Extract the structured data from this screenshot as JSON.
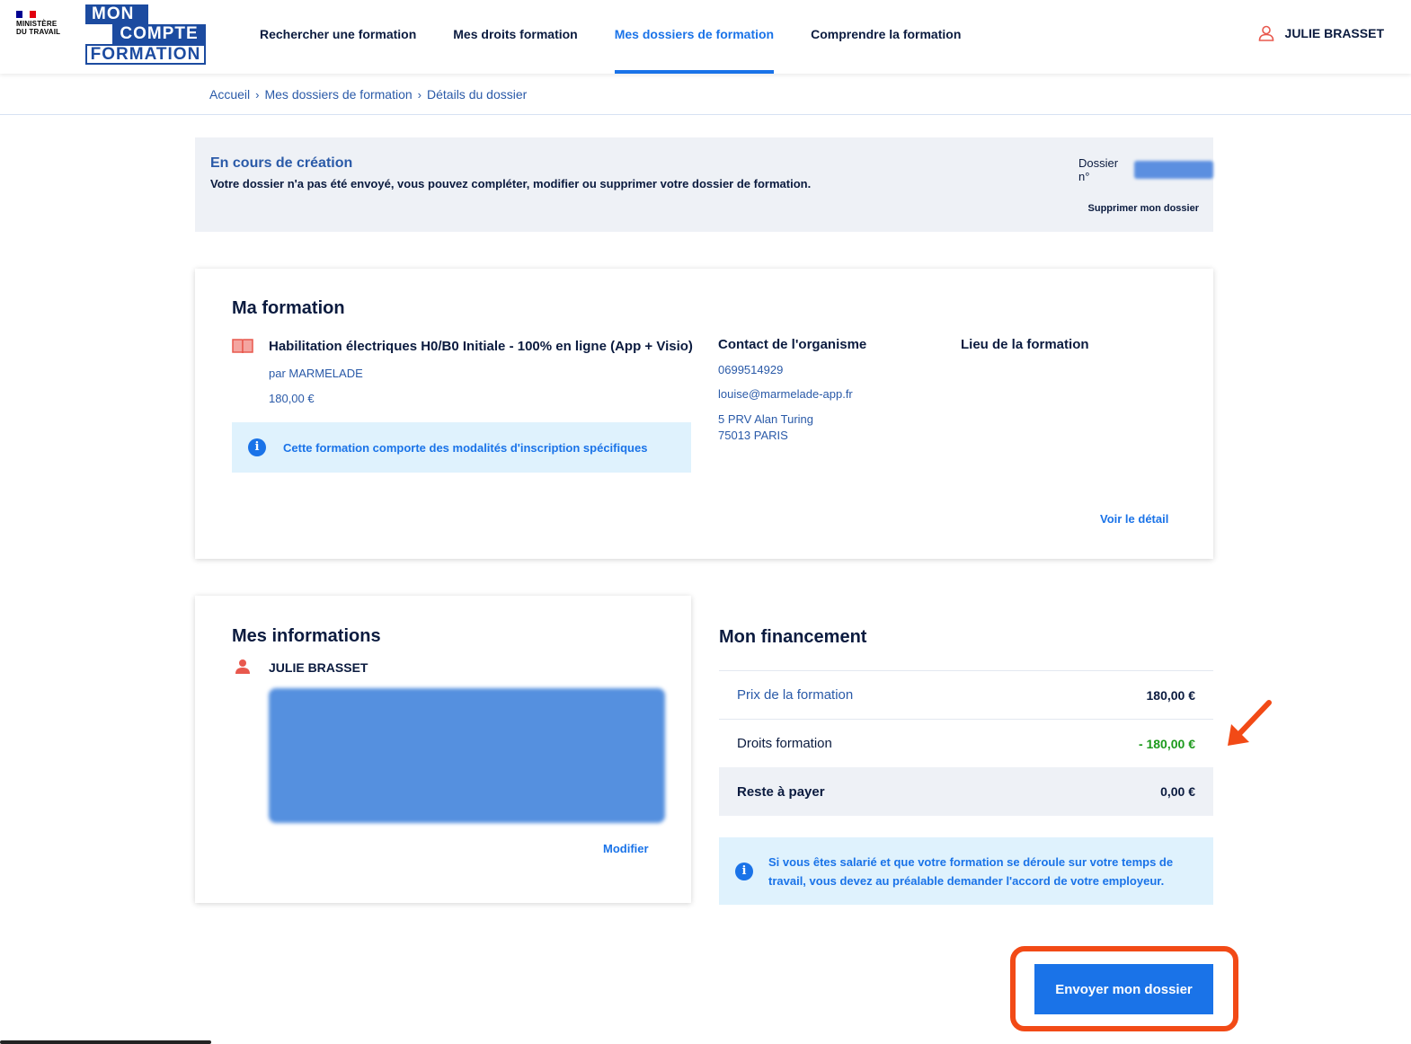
{
  "header": {
    "ministere_line1": "MINISTÈRE",
    "ministere_line2": "DU TRAVAIL",
    "logo_line1": "MON",
    "logo_line2": "COMPTE",
    "logo_line3": "FORMATION",
    "nav": [
      {
        "label": "Rechercher une formation",
        "active": false
      },
      {
        "label": "Mes droits formation",
        "active": false
      },
      {
        "label": "Mes dossiers de formation",
        "active": true
      },
      {
        "label": "Comprendre la formation",
        "active": false
      }
    ],
    "user_name": "JULIE BRASSET"
  },
  "breadcrumb": [
    "Accueil",
    "Mes dossiers de formation",
    "Détails du dossier"
  ],
  "status": {
    "title": "En cours de création",
    "text": "Votre dossier n'a pas été envoyé, vous pouvez compléter, modifier ou supprimer votre dossier de formation.",
    "dossier_label": "Dossier n°",
    "delete_label": "Supprimer mon dossier"
  },
  "formation": {
    "section_title": "Ma formation",
    "name": "Habilitation électriques H0/B0 Initiale - 100% en ligne (App + Visio)",
    "by": "par MARMELADE",
    "price": "180,00 €",
    "info": "Cette formation comporte des modalités d'inscription spécifiques",
    "contact_title": "Contact de l'organisme",
    "phone": "0699514929",
    "email": "louise@marmelade-app.fr",
    "address_line1": "5 PRV Alan Turing",
    "address_line2": "75013 PARIS",
    "lieu_title": "Lieu de la formation",
    "detail_link": "Voir le détail"
  },
  "infos": {
    "section_title": "Mes informations",
    "name": "JULIE BRASSET",
    "modify_link": "Modifier"
  },
  "financement": {
    "section_title": "Mon financement",
    "rows": [
      {
        "label": "Prix de la formation",
        "value": "180,00 €"
      },
      {
        "label": "Droits formation",
        "value": "- 180,00 €"
      },
      {
        "label": "Reste à payer",
        "value": "0,00 €"
      }
    ],
    "info": "Si vous êtes salarié et que votre formation se déroule sur votre temps de travail, vous devez au préalable demander l'accord de votre employeur."
  },
  "actions": {
    "send_label": "Envoyer mon dossier"
  },
  "colors": {
    "primary": "#1a73e8",
    "navy": "#0b1b3f",
    "annotation": "#f24a16",
    "green": "#1c9a1c"
  }
}
